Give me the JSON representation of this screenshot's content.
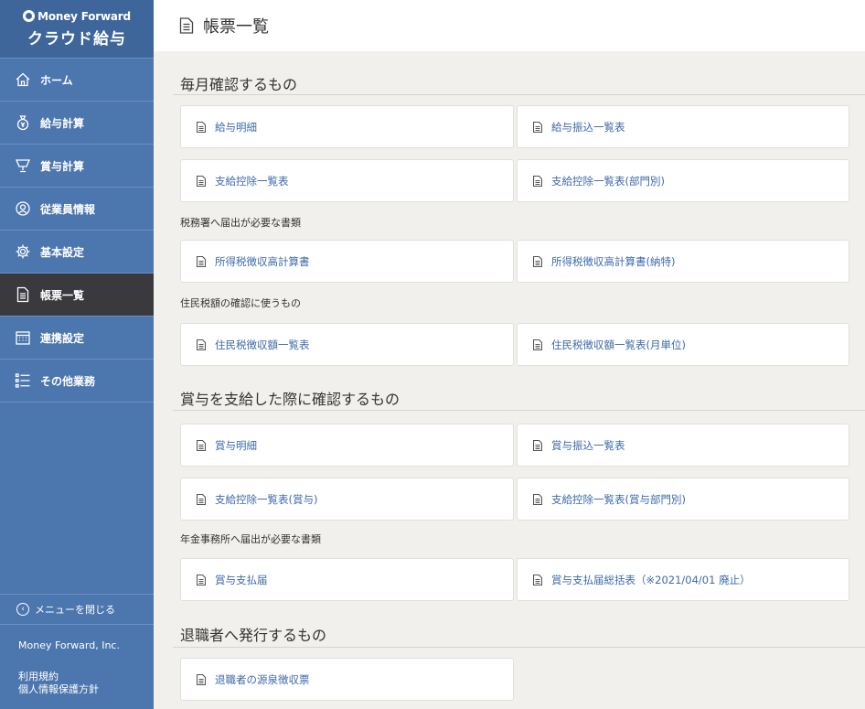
{
  "brand": {
    "name": "Money Forward",
    "product": "クラウド給与"
  },
  "nav": [
    {
      "id": "home",
      "label": "ホーム",
      "icon": "home-icon"
    },
    {
      "id": "salary",
      "label": "給与計算",
      "icon": "money-bag-icon"
    },
    {
      "id": "bonus",
      "label": "賞与計算",
      "icon": "trophy-icon"
    },
    {
      "id": "employees",
      "label": "従業員情報",
      "icon": "person-icon"
    },
    {
      "id": "settings",
      "label": "基本設定",
      "icon": "gear-icon"
    },
    {
      "id": "reports",
      "label": "帳票一覧",
      "icon": "document-icon",
      "active": true
    },
    {
      "id": "integration",
      "label": "連携設定",
      "icon": "calendar-icon"
    },
    {
      "id": "other",
      "label": "その他業務",
      "icon": "list-icon"
    }
  ],
  "sidebar_footer": {
    "close_menu": "メニューを閉じる",
    "company": "Money Forward, Inc.",
    "links": [
      "利用規約",
      "個人情報保護方針"
    ]
  },
  "header": {
    "title": "帳票一覧"
  },
  "sections": {
    "monthly": {
      "title": "毎月確認するもの",
      "cards": [
        "給与明細",
        "給与振込一覧表",
        "支給控除一覧表",
        "支給控除一覧表(部門別)"
      ],
      "sub1": {
        "title": "税務署へ届出が必要な書類",
        "cards": [
          "所得税徴収高計算書",
          "所得税徴収高計算書(納特)"
        ]
      },
      "sub2": {
        "title": "住民税額の確認に使うもの",
        "cards": [
          "住民税徴収額一覧表",
          "住民税徴収額一覧表(月単位)"
        ]
      }
    },
    "bonus": {
      "title": "賞与を支給した際に確認するもの",
      "cards": [
        "賞与明細",
        "賞与振込一覧表",
        "支給控除一覧表(賞与)",
        "支給控除一覧表(賞与部門別)"
      ],
      "sub1": {
        "title": "年金事務所へ届出が必要な書類",
        "cards": [
          "賞与支払届",
          "賞与支払届総括表（※2021/04/01 廃止）"
        ]
      }
    },
    "retired": {
      "title": "退職者へ発行するもの",
      "cards": [
        "退職者の源泉徴収票"
      ]
    }
  }
}
